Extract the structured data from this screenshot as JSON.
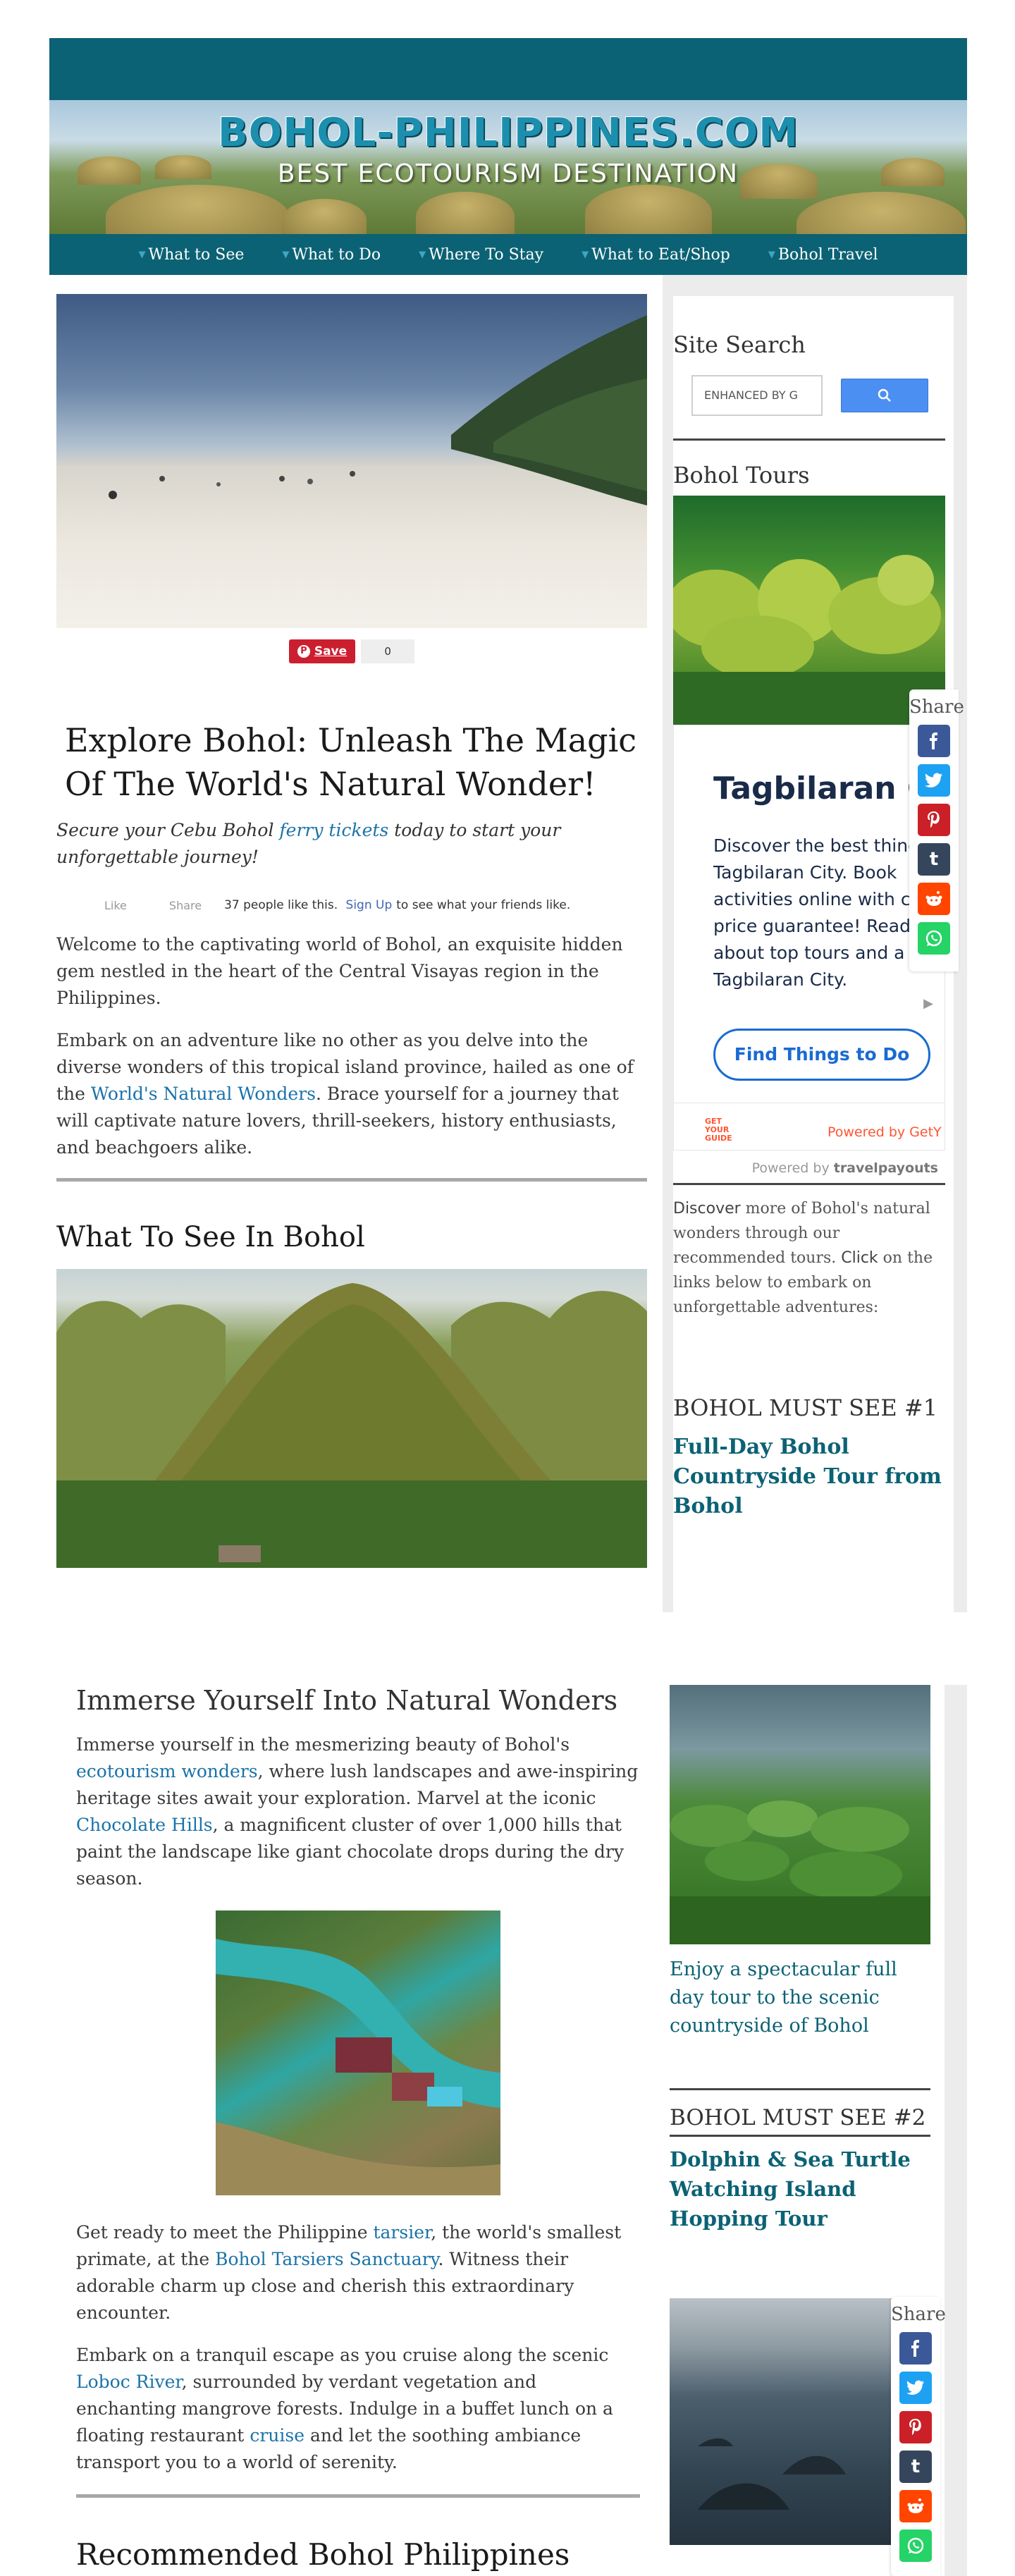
{
  "header": {
    "site_title": "BOHOL-PHILIPPINES.COM",
    "tagline": "BEST ECOTOURISM DESTINATION",
    "nav": [
      {
        "label": "What to See"
      },
      {
        "label": "What to Do"
      },
      {
        "label": "Where To Stay"
      },
      {
        "label": "What to Eat/Shop"
      },
      {
        "label": "Bohol Travel"
      }
    ]
  },
  "main": {
    "pin_save_label": "Save",
    "pin_count": "0",
    "title": "Explore Bohol: Unleash The Magic Of The World's Natural Wonder!",
    "lead_before": "Secure your Cebu Bohol ",
    "lead_link": "ferry tickets",
    "lead_after": " today to start your unforgettable journey!",
    "fb": {
      "like": "Like",
      "share": "Share",
      "count_text": "37 people like this.",
      "signup": "Sign Up",
      "after": "to see what your friends like."
    },
    "para1": "Welcome to the captivating world of Bohol, an exquisite hidden gem nestled in the heart of the Central Visayas region in the Philippines.",
    "para2_before": "Embark on an adventure like no other as you delve into the diverse wonders of this tropical island province, hailed as one of the ",
    "para2_link": "World's Natural Wonders",
    "para2_after": ". Brace yourself for a journey that will captivate nature lovers, thrill-seekers, history enthusiasts, and beachgoers alike.",
    "section_heading": "What To See In Bohol"
  },
  "sidebar": {
    "search_title": "Site Search",
    "search_placeholder": "ENHANCED BY G",
    "tours_title": "Bohol Tours",
    "widget": {
      "title": "Tagbilaran C",
      "text": "Discover the best thing Tagbilaran City. Book activities online with c price guarantee! Read about top tours and a in Tagbilaran City.",
      "button": "Find Things to Do",
      "logo_line1": "GET",
      "logo_line2": "YOUR",
      "logo_line3": "GUIDE",
      "powered": "Powered by GetY"
    },
    "travelpayouts_prefix": "Powered by",
    "travelpayouts_brand": "travelpayouts",
    "discover_word": "Discover",
    "discover_mid": " more of Bohol's natural wonders through our recommended tours. ",
    "click_word": "Click",
    "discover_end": " on the links below to embark on unforgettable adventures:",
    "must_see_1_label": "BOHOL MUST SEE #1",
    "must_see_1_title": "Full-Day Bohol Countryside Tour from Bohol"
  },
  "share": {
    "label": "Share",
    "icons": [
      "facebook-icon",
      "twitter-icon",
      "pinterest-icon",
      "tumblr-icon",
      "reddit-icon",
      "whatsapp-icon"
    ],
    "colors": {
      "facebook": "#3b5998",
      "twitter": "#1da1f2",
      "pinterest": "#cb2027",
      "tumblr": "#35465c",
      "reddit": "#ff4500",
      "whatsapp": "#25d366"
    }
  },
  "section2": {
    "heading": "Immerse Yourself Into Natural Wonders",
    "p1_a": "Immerse yourself in the mesmerizing beauty of Bohol's ",
    "p1_link1": "ecotourism wonders",
    "p1_b": ", where lush landscapes and awe-inspiring heritage sites await your exploration. Marvel at the iconic ",
    "p1_link2": "Chocolate Hills",
    "p1_c": ", a magnificent cluster of over 1,000 hills that paint the landscape like giant chocolate drops during the dry season.",
    "p2_a": "Get ready to meet the Philippine ",
    "p2_link1": "tarsier",
    "p2_b": ", the world's smallest primate, at the ",
    "p2_link2": "Bohol Tarsiers Sanctuary",
    "p2_c": ". Witness their adorable charm up close and cherish this extraordinary encounter.",
    "p3_a": "Embark on a tranquil escape as you cruise along the scenic ",
    "p3_link1": "Loboc River",
    "p3_b": ", surrounded by verdant vegetation and enchanting mangrove forests. Indulge in a buffet lunch on a floating restaurant ",
    "p3_link2": "cruise",
    "p3_c": " and let the soothing ambiance transport you to a world of serenity.",
    "heading2": "Recommended Bohol Philippines Tours"
  },
  "sidebar2": {
    "caption": "Enjoy a spectacular full day tour to the scenic countryside of Bohol",
    "must_see_2_label": "BOHOL MUST SEE #2",
    "must_see_2_title": "Dolphin & Sea Turtle Watching Island Hopping Tour"
  },
  "colors": {
    "brand_teal": "#0b6274",
    "link_blue": "#1a73a8",
    "search_button": "#4b8ff3",
    "widget_button": "#1a6bd1",
    "getyourguide_orange": "#ff5533"
  }
}
